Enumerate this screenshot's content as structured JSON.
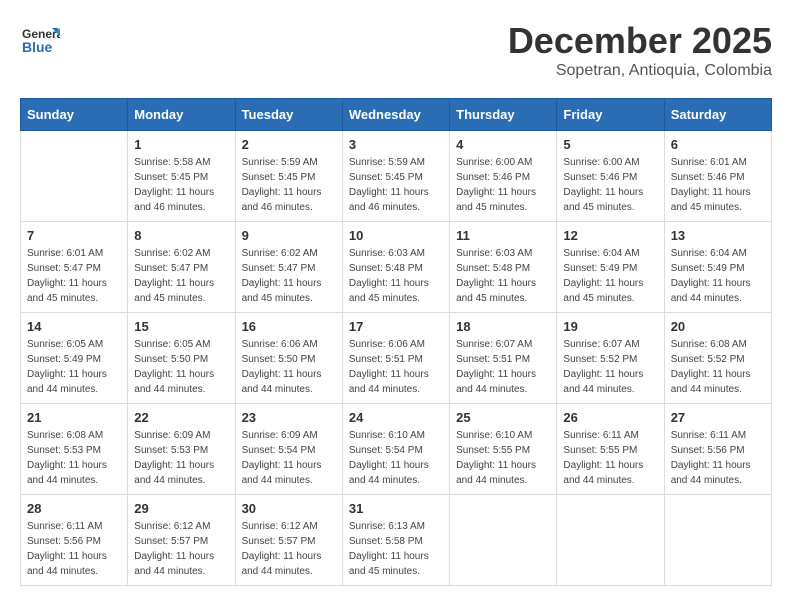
{
  "header": {
    "logo": "GeneralBlue",
    "title": "December 2025",
    "location": "Sopetran, Antioquia, Colombia"
  },
  "weekdays": [
    "Sunday",
    "Monday",
    "Tuesday",
    "Wednesday",
    "Thursday",
    "Friday",
    "Saturday"
  ],
  "weeks": [
    [
      {
        "day": "",
        "info": ""
      },
      {
        "day": "1",
        "info": "Sunrise: 5:58 AM\nSunset: 5:45 PM\nDaylight: 11 hours\nand 46 minutes."
      },
      {
        "day": "2",
        "info": "Sunrise: 5:59 AM\nSunset: 5:45 PM\nDaylight: 11 hours\nand 46 minutes."
      },
      {
        "day": "3",
        "info": "Sunrise: 5:59 AM\nSunset: 5:45 PM\nDaylight: 11 hours\nand 46 minutes."
      },
      {
        "day": "4",
        "info": "Sunrise: 6:00 AM\nSunset: 5:46 PM\nDaylight: 11 hours\nand 45 minutes."
      },
      {
        "day": "5",
        "info": "Sunrise: 6:00 AM\nSunset: 5:46 PM\nDaylight: 11 hours\nand 45 minutes."
      },
      {
        "day": "6",
        "info": "Sunrise: 6:01 AM\nSunset: 5:46 PM\nDaylight: 11 hours\nand 45 minutes."
      }
    ],
    [
      {
        "day": "7",
        "info": "Sunrise: 6:01 AM\nSunset: 5:47 PM\nDaylight: 11 hours\nand 45 minutes."
      },
      {
        "day": "8",
        "info": "Sunrise: 6:02 AM\nSunset: 5:47 PM\nDaylight: 11 hours\nand 45 minutes."
      },
      {
        "day": "9",
        "info": "Sunrise: 6:02 AM\nSunset: 5:47 PM\nDaylight: 11 hours\nand 45 minutes."
      },
      {
        "day": "10",
        "info": "Sunrise: 6:03 AM\nSunset: 5:48 PM\nDaylight: 11 hours\nand 45 minutes."
      },
      {
        "day": "11",
        "info": "Sunrise: 6:03 AM\nSunset: 5:48 PM\nDaylight: 11 hours\nand 45 minutes."
      },
      {
        "day": "12",
        "info": "Sunrise: 6:04 AM\nSunset: 5:49 PM\nDaylight: 11 hours\nand 45 minutes."
      },
      {
        "day": "13",
        "info": "Sunrise: 6:04 AM\nSunset: 5:49 PM\nDaylight: 11 hours\nand 44 minutes."
      }
    ],
    [
      {
        "day": "14",
        "info": "Sunrise: 6:05 AM\nSunset: 5:49 PM\nDaylight: 11 hours\nand 44 minutes."
      },
      {
        "day": "15",
        "info": "Sunrise: 6:05 AM\nSunset: 5:50 PM\nDaylight: 11 hours\nand 44 minutes."
      },
      {
        "day": "16",
        "info": "Sunrise: 6:06 AM\nSunset: 5:50 PM\nDaylight: 11 hours\nand 44 minutes."
      },
      {
        "day": "17",
        "info": "Sunrise: 6:06 AM\nSunset: 5:51 PM\nDaylight: 11 hours\nand 44 minutes."
      },
      {
        "day": "18",
        "info": "Sunrise: 6:07 AM\nSunset: 5:51 PM\nDaylight: 11 hours\nand 44 minutes."
      },
      {
        "day": "19",
        "info": "Sunrise: 6:07 AM\nSunset: 5:52 PM\nDaylight: 11 hours\nand 44 minutes."
      },
      {
        "day": "20",
        "info": "Sunrise: 6:08 AM\nSunset: 5:52 PM\nDaylight: 11 hours\nand 44 minutes."
      }
    ],
    [
      {
        "day": "21",
        "info": "Sunrise: 6:08 AM\nSunset: 5:53 PM\nDaylight: 11 hours\nand 44 minutes."
      },
      {
        "day": "22",
        "info": "Sunrise: 6:09 AM\nSunset: 5:53 PM\nDaylight: 11 hours\nand 44 minutes."
      },
      {
        "day": "23",
        "info": "Sunrise: 6:09 AM\nSunset: 5:54 PM\nDaylight: 11 hours\nand 44 minutes."
      },
      {
        "day": "24",
        "info": "Sunrise: 6:10 AM\nSunset: 5:54 PM\nDaylight: 11 hours\nand 44 minutes."
      },
      {
        "day": "25",
        "info": "Sunrise: 6:10 AM\nSunset: 5:55 PM\nDaylight: 11 hours\nand 44 minutes."
      },
      {
        "day": "26",
        "info": "Sunrise: 6:11 AM\nSunset: 5:55 PM\nDaylight: 11 hours\nand 44 minutes."
      },
      {
        "day": "27",
        "info": "Sunrise: 6:11 AM\nSunset: 5:56 PM\nDaylight: 11 hours\nand 44 minutes."
      }
    ],
    [
      {
        "day": "28",
        "info": "Sunrise: 6:11 AM\nSunset: 5:56 PM\nDaylight: 11 hours\nand 44 minutes."
      },
      {
        "day": "29",
        "info": "Sunrise: 6:12 AM\nSunset: 5:57 PM\nDaylight: 11 hours\nand 44 minutes."
      },
      {
        "day": "30",
        "info": "Sunrise: 6:12 AM\nSunset: 5:57 PM\nDaylight: 11 hours\nand 44 minutes."
      },
      {
        "day": "31",
        "info": "Sunrise: 6:13 AM\nSunset: 5:58 PM\nDaylight: 11 hours\nand 45 minutes."
      },
      {
        "day": "",
        "info": ""
      },
      {
        "day": "",
        "info": ""
      },
      {
        "day": "",
        "info": ""
      }
    ]
  ]
}
